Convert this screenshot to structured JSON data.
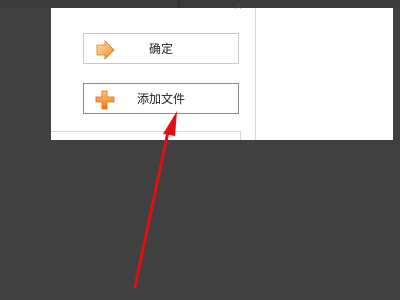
{
  "dialog": {
    "close_glyph": "×",
    "confirm_button": {
      "label": "确定",
      "icon": "arrow-right-icon"
    },
    "add_file_button": {
      "label": "添加文件",
      "icon": "plus-icon"
    }
  },
  "annotation": {
    "arrow_color": "#e01010"
  }
}
